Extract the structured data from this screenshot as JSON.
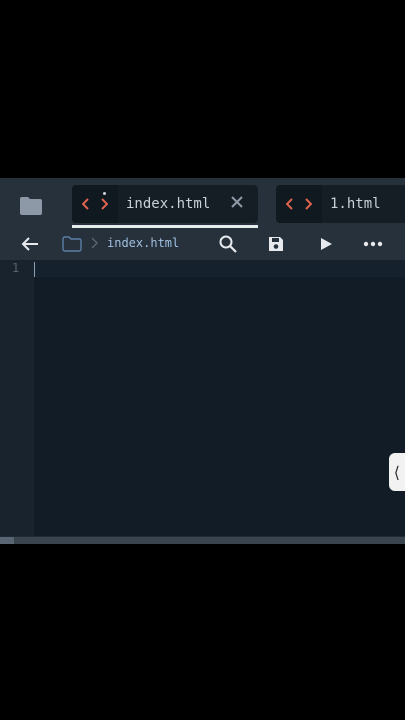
{
  "tabs": [
    {
      "label": "index.html",
      "active": true,
      "modified": true
    },
    {
      "label": "1.html",
      "active": false,
      "modified": false
    }
  ],
  "breadcrumb": {
    "file": "index.html"
  },
  "editor": {
    "line_numbers": [
      "1"
    ]
  },
  "icons": {
    "folder": "folder-icon",
    "back": "arrow-left-icon",
    "search": "search-icon",
    "save": "save-icon",
    "run": "play-icon",
    "more": "more-icon",
    "handle": "chevron-left-icon"
  },
  "handle_glyph": "⟨",
  "colors": {
    "code_icon": "#e0634f",
    "background": "#1f2a35",
    "editor": "#121c26"
  }
}
